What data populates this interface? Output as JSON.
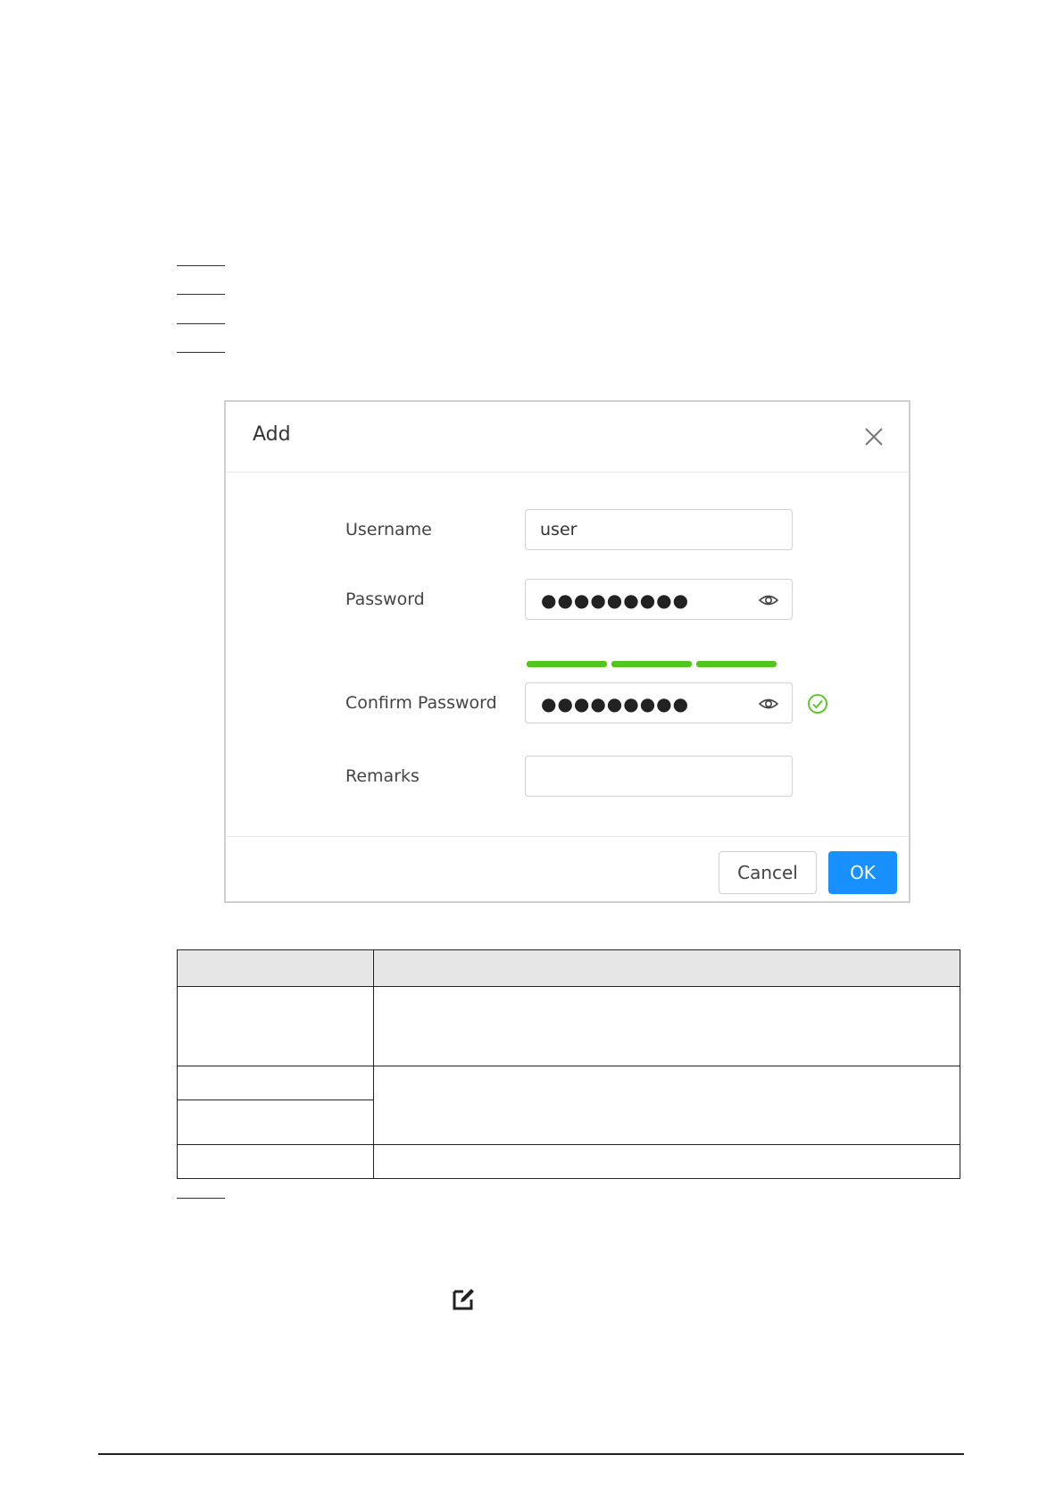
{
  "dialog": {
    "title": "Add",
    "fields": {
      "username": {
        "label": "Username",
        "value": "user"
      },
      "password": {
        "label": "Password",
        "masked_value": "●●●●●●●●●"
      },
      "confirm_password": {
        "label": "Confirm Password",
        "masked_value": "●●●●●●●●●"
      },
      "remarks": {
        "label": "Remarks",
        "value": ""
      }
    },
    "password_strength": {
      "level": 3,
      "max": 3,
      "color": "#52c41a"
    },
    "buttons": {
      "cancel_label": "Cancel",
      "ok_label": "OK"
    },
    "colors": {
      "primary": "#1890ff",
      "valid": "#52c41a"
    }
  },
  "icons": {
    "close": "close-icon",
    "eye": "eye-icon",
    "check": "check-circle-icon",
    "edit": "edit-icon"
  }
}
